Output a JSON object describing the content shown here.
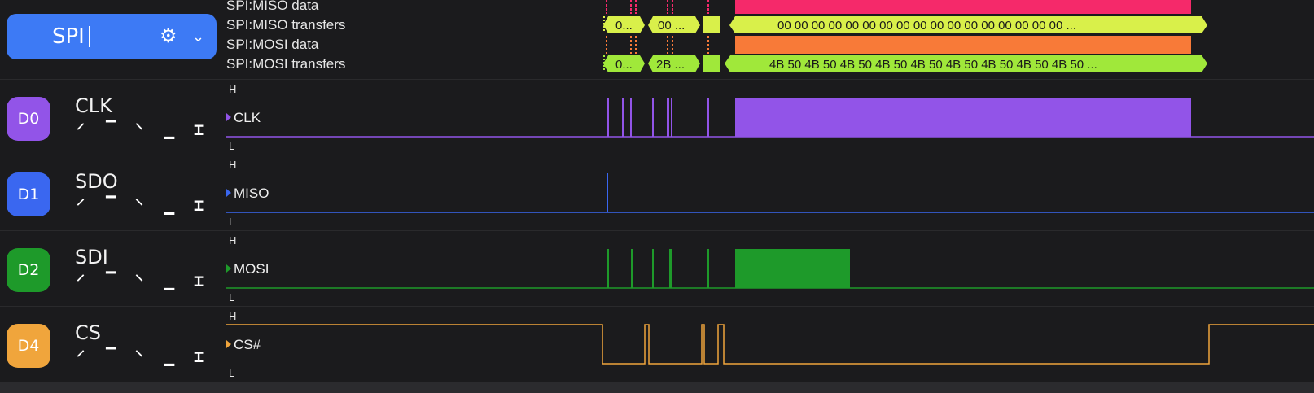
{
  "spi_button": {
    "label": "SPI",
    "icon_gear": "gear-icon",
    "icon_chevron": "chevron-down-icon",
    "color": "#3d7af5"
  },
  "decoder_rows": [
    {
      "label": "SPI:MISO data"
    },
    {
      "label": "SPI:MISO transfers",
      "long_text": "00 00 00 00 00 00 00 00 00 00 00 00 00 00 00 00 00 ...",
      "short_a": "0...",
      "short_b": "00 ..."
    },
    {
      "label": "SPI:MOSI data"
    },
    {
      "label": "SPI:MOSI transfers",
      "long_text": "4B 50 4B 50 4B 50 4B 50 4B 50 4B 50 4B 50 4B 50 4B 50 ...",
      "short_a": "0...",
      "short_b": "2B ..."
    }
  ],
  "channels": [
    {
      "badge": "D0",
      "name": "CLK",
      "signal": "CLK",
      "color": "#9254e8",
      "high": "H",
      "low": "L"
    },
    {
      "badge": "D1",
      "name": "SDO",
      "signal": "MISO",
      "color": "#3a67f0",
      "high": "H",
      "low": "L"
    },
    {
      "badge": "D2",
      "name": "SDI",
      "signal": "MOSI",
      "color": "#1e9a2a",
      "high": "H",
      "low": "L"
    },
    {
      "badge": "D4",
      "name": "CS",
      "signal": "CS#",
      "color": "#f0a53c",
      "high": "H",
      "low": "L"
    }
  ],
  "trigger_icons": [
    "rising-edge-icon",
    "high-level-icon",
    "falling-edge-icon",
    "low-level-icon",
    "any-edge-icon"
  ],
  "colors": {
    "miso_data": "#f5296a",
    "mosi_data": "#f87a38",
    "transfer": "#d9f04a",
    "mosi_transfer": "#a0e83a"
  }
}
